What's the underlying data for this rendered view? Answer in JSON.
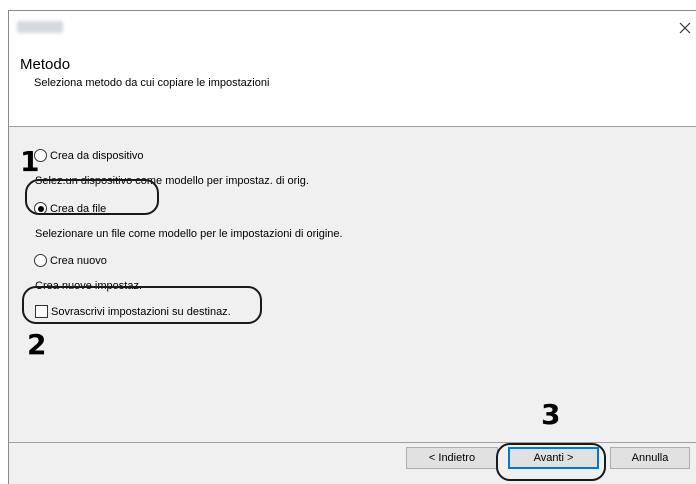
{
  "window": {
    "title_blurred": "Mobile Sync"
  },
  "header": {
    "title": "Metodo",
    "subtitle": "Seleziona metodo da cui copiare le impostazioni"
  },
  "options": [
    {
      "label": "Crea da dispositivo",
      "description": "Selez.un dispositivo come modello per impostaz. di orig.",
      "selected": false
    },
    {
      "label": "Crea da file",
      "description": "Selezionare un file come modello per le impostazioni di origine.",
      "selected": true
    },
    {
      "label": "Crea nuovo",
      "description": "Crea nuove impostaz.",
      "selected": false
    }
  ],
  "overwrite": {
    "label": "Sovrascrivi impostazioni su destinaz.",
    "checked": false
  },
  "buttons": {
    "back": "< Indietro",
    "next": "Avanti >",
    "cancel": "Annulla"
  },
  "steps": {
    "one": "1",
    "two": "2",
    "three": "3"
  },
  "colors": {
    "accent": "#0078d7",
    "callout": "#1a1a1a"
  }
}
